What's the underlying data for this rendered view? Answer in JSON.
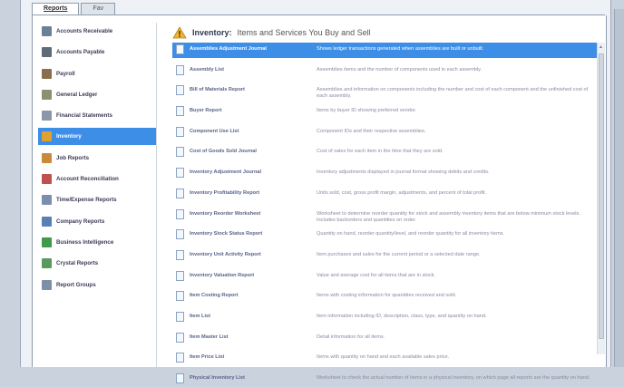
{
  "tabs": [
    {
      "label": "Reports",
      "active": true
    },
    {
      "label": "Fav",
      "active": false
    }
  ],
  "sidebar": {
    "items": [
      {
        "label": "Accounts Receivable",
        "icon": "money-icon",
        "color": "#6b7f96"
      },
      {
        "label": "Accounts Payable",
        "icon": "ledger-icon",
        "color": "#5e6b79"
      },
      {
        "label": "Payroll",
        "icon": "payroll-icon",
        "color": "#8a6d4e"
      },
      {
        "label": "General Ledger",
        "icon": "book-icon",
        "color": "#8e8f6e"
      },
      {
        "label": "Financial Statements",
        "icon": "statement-icon",
        "color": "#8b97a8"
      },
      {
        "label": "Inventory",
        "icon": "inventory-icon",
        "color": "#e0a22e",
        "selected": true
      },
      {
        "label": "Job Reports",
        "icon": "job-icon",
        "color": "#c98a3c"
      },
      {
        "label": "Account Reconciliation",
        "icon": "reconcile-icon",
        "color": "#c0504d"
      },
      {
        "label": "Time/Expense Reports",
        "icon": "time-icon",
        "color": "#7a8fae"
      },
      {
        "label": "Company Reports",
        "icon": "company-icon",
        "color": "#5b7fb2"
      },
      {
        "label": "Business Intelligence",
        "icon": "chart-icon",
        "color": "#3f9a4a"
      },
      {
        "label": "Crystal Reports",
        "icon": "crystal-icon",
        "color": "#5b9a5e"
      },
      {
        "label": "Report Groups",
        "icon": "group-icon",
        "color": "#7d8fa6"
      }
    ]
  },
  "content": {
    "title": "Inventory:",
    "subtitle": "Items and Services You Buy and Sell"
  },
  "reports": [
    {
      "name": "Assemblies Adjustment Journal",
      "desc": "Shows ledger transactions generated when assemblies are built or unbuilt.",
      "selected": true
    },
    {
      "name": "Assembly List",
      "desc": "Assemblies items and the number of components used in each assembly."
    },
    {
      "name": "Bill of Materials Report",
      "desc": "Assemblies and information on components including the number and cost of each component and the unfinished cost of each assembly."
    },
    {
      "name": "Buyer Report",
      "desc": "Items by buyer ID showing preferred vendor."
    },
    {
      "name": "Component Use List",
      "desc": "Component IDs and their respective assemblies."
    },
    {
      "name": "Cost of Goods Sold Journal",
      "desc": "Cost of sales for each item in the time that they are sold."
    },
    {
      "name": "Inventory Adjustment Journal",
      "desc": "Inventory adjustments displayed in journal format showing debits and credits."
    },
    {
      "name": "Inventory Profitability Report",
      "desc": "Units sold, cost, gross profit margin, adjustments, and percent of total profit."
    },
    {
      "name": "Inventory Reorder Worksheet",
      "desc": "Worksheet to determine reorder quantity for stock and assembly inventory items that are below minimum stock levels. Includes backorders and quantities on order."
    },
    {
      "name": "Inventory Stock Status Report",
      "desc": "Quantity on hand, reorder quantity/level, and reorder quantity for all inventory items."
    },
    {
      "name": "Inventory Unit Activity Report",
      "desc": "Item purchases and sales for the current period or a selected date range."
    },
    {
      "name": "Inventory Valuation Report",
      "desc": "Value and average cost for all items that are in stock."
    },
    {
      "name": "Item Costing Report",
      "desc": "Items with costing information for quantities received and sold."
    },
    {
      "name": "Item List",
      "desc": "Item information including ID, description, class, type, and quantity on hand."
    },
    {
      "name": "Item Master List",
      "desc": "Detail information for all items."
    },
    {
      "name": "Item Price List",
      "desc": "Items with quantity on hand and each available sales price."
    },
    {
      "name": "Physical Inventory List",
      "desc": "Worksheet to check the actual number of items in a physical inventory, on which page all reports are the quantity on hand."
    }
  ]
}
